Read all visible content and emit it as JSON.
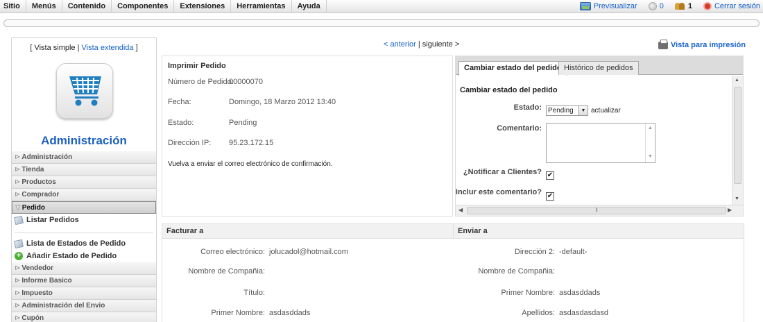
{
  "top_menu": {
    "items": [
      "Sitio",
      "Menús",
      "Contenido",
      "Componentes",
      "Extensiones",
      "Herramientas",
      "Ayuda"
    ],
    "preview_label": "Previsualizar",
    "messages_count": "0",
    "users_count": "1",
    "logout_label": "Cerrar sesión"
  },
  "sidebar": {
    "view_simple": "[ Vista simple |",
    "view_extended": "Vista extendida",
    "view_close": "]",
    "title": "Administración",
    "nav_before": [
      "Administración",
      "Tienda",
      "Productos",
      "Comprador"
    ],
    "active_item": "Pedido",
    "sub_items": [
      "Listar Pedidos",
      "Lista de Estados de Pedido",
      "Añadir Estado de Pedido"
    ],
    "nav_after": [
      "Vendedor",
      "Informe Basico",
      "Impuesto",
      "Administración del Envio",
      "Cupón"
    ]
  },
  "pager": {
    "prev": "< anterior",
    "sep": "|",
    "next": "siguiente >"
  },
  "print_view": "Vista para impresión",
  "order": {
    "title": "Imprimir Pedido",
    "fields": [
      {
        "label": "Número de Pedido:",
        "value": "00000070"
      },
      {
        "label": "Fecha:",
        "value": "Domingo, 18 Marzo 2012 13:40"
      },
      {
        "label": "Estado:",
        "value": "Pending"
      },
      {
        "label": "Dirección IP:",
        "value": "95.23.172.15"
      }
    ],
    "resend": "Vuelva a enviar el correo electrónico de confirmación."
  },
  "tabs": {
    "active": "Cambiar estado del pedido",
    "other": "Histórico de pedidos"
  },
  "status_change": {
    "title": "Cambiar estado del pedido",
    "estado_label": "Estado:",
    "estado_value": "Pending",
    "update_label": "actualizar",
    "comment_label": "Comentario:",
    "notify_label": "¿Notificar a Clientes?",
    "include_label": "¿Inclur este comentario?",
    "check_mark": "✔"
  },
  "billing": {
    "title": "Facturar a",
    "rows": [
      {
        "label": "Correo electrónico:",
        "value": "jolucadol@hotmail.com"
      },
      {
        "label": "Nombre de Compañia:",
        "value": ""
      },
      {
        "label": "Título:",
        "value": ""
      },
      {
        "label": "Primer Nombre:",
        "value": "asdasddads"
      }
    ]
  },
  "shipping": {
    "title": "Enviar a",
    "rows": [
      {
        "label": "Dirección 2:",
        "value": "-default-"
      },
      {
        "label": "Nombre de Compañia:",
        "value": ""
      },
      {
        "label": "Primer Nombre:",
        "value": "asdasddads"
      },
      {
        "label": "Apellidos:",
        "value": "asdasdasdasd"
      }
    ]
  }
}
